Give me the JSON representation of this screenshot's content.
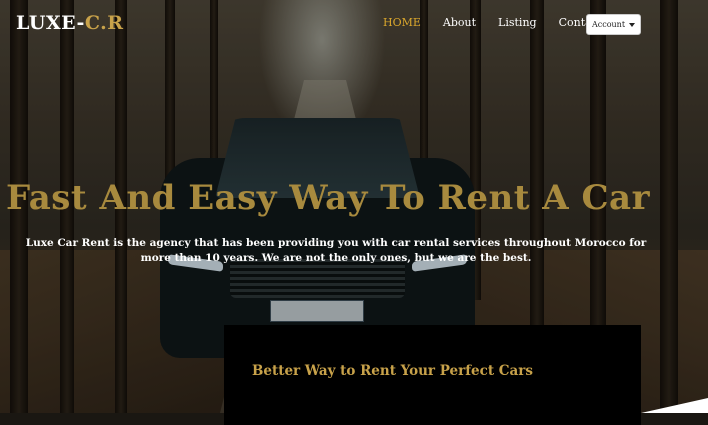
{
  "brand": {
    "prefix": "LUXE-",
    "accent": "C.R"
  },
  "nav": {
    "items": [
      {
        "label": "HOME",
        "active": true
      },
      {
        "label": "About"
      },
      {
        "label": "Listing"
      },
      {
        "label": "Contact"
      }
    ],
    "account_label": "Account"
  },
  "hero": {
    "headline": "Fast And Easy Way To Rent A Car",
    "description": "Luxe Car Rent is the agency that has been providing you with car rental services throughout Morocco for more than 10 years. We are not the only ones, but we are the best."
  },
  "panel": {
    "title": "Better Way to Rent Your Perfect Cars"
  },
  "colors": {
    "accent": "#c8a24a",
    "active_nav": "#d9a62c",
    "headline": "#a88a3e"
  }
}
